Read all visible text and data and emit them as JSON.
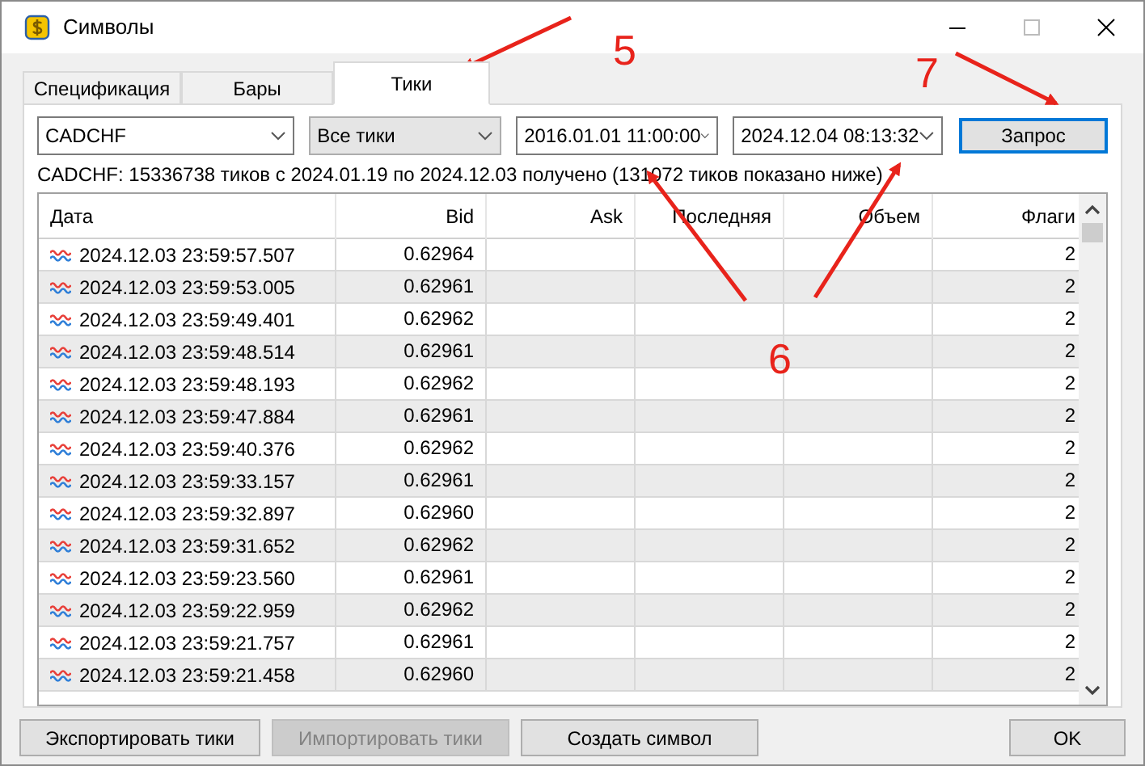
{
  "window": {
    "title": "Символы"
  },
  "tabs": [
    {
      "label": "Спецификация",
      "selected": false
    },
    {
      "label": "Бары",
      "selected": false
    },
    {
      "label": "Тики",
      "selected": true
    }
  ],
  "filters": [
    {
      "kind": "edit",
      "value": "CADCHF"
    },
    {
      "kind": "list",
      "value": "Все тики"
    },
    {
      "kind": "edit",
      "value": "2016.01.01 11:00:00"
    },
    {
      "kind": "edit",
      "value": "2024.12.04 08:13:32"
    }
  ],
  "request_button": {
    "label": "Запрос",
    "focused": true
  },
  "info": "CADCHF: 15336738 тиков с 2024.01.19 по 2024.12.03 получено (131072 тиков показано ниже)",
  "table": {
    "columns": [
      "Дата",
      "Bid",
      "Ask",
      "Последняя",
      "Объем",
      "Флаги"
    ],
    "rows": [
      [
        "2024.12.03 23:59:57.507",
        "0.62964",
        "2"
      ],
      [
        "2024.12.03 23:59:53.005",
        "0.62961",
        "2"
      ],
      [
        "2024.12.03 23:59:49.401",
        "0.62962",
        "2"
      ],
      [
        "2024.12.03 23:59:48.514",
        "0.62961",
        "2"
      ],
      [
        "2024.12.03 23:59:48.193",
        "0.62962",
        "2"
      ],
      [
        "2024.12.03 23:59:47.884",
        "0.62961",
        "2"
      ],
      [
        "2024.12.03 23:59:40.376",
        "0.62962",
        "2"
      ],
      [
        "2024.12.03 23:59:33.157",
        "0.62961",
        "2"
      ],
      [
        "2024.12.03 23:59:32.897",
        "0.62960",
        "2"
      ],
      [
        "2024.12.03 23:59:31.652",
        "0.62962",
        "2"
      ],
      [
        "2024.12.03 23:59:23.560",
        "0.62961",
        "2"
      ],
      [
        "2024.12.03 23:59:22.959",
        "0.62962",
        "2"
      ],
      [
        "2024.12.03 23:59:21.757",
        "0.62961",
        "2"
      ],
      [
        "2024.12.03 23:59:21.458",
        "0.62960",
        "2"
      ]
    ]
  },
  "buttons": [
    {
      "label": "Экспортировать тики",
      "disabled": false
    },
    {
      "label": "Импортировать тики",
      "disabled": true
    },
    {
      "label": "Создать символ",
      "disabled": false
    },
    {
      "label": "OK",
      "disabled": false
    }
  ],
  "annotations": [
    "5",
    "6",
    "7"
  ]
}
